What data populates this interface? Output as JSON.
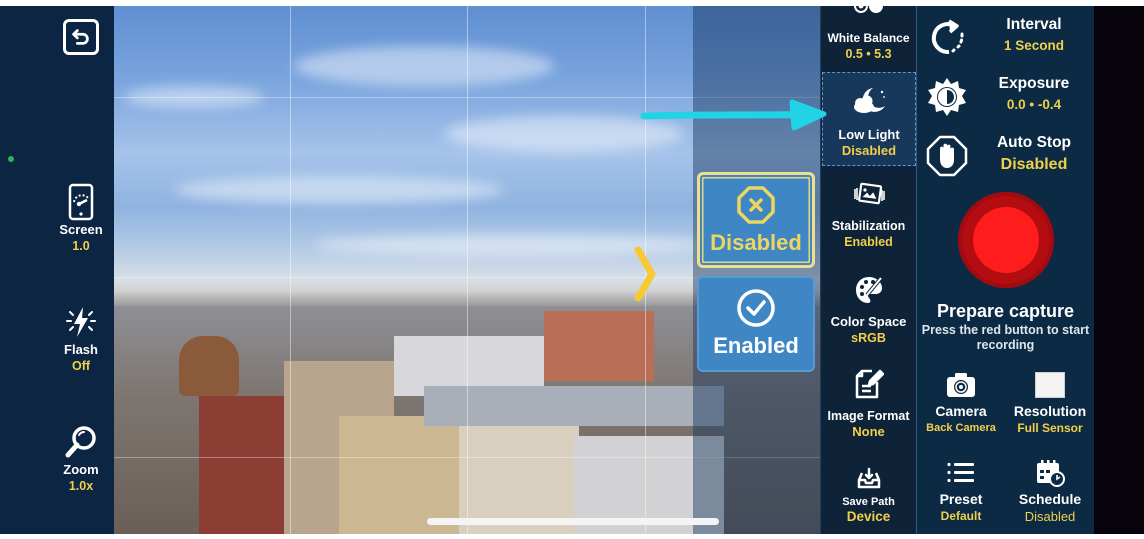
{
  "left_sidebar": {
    "back_icon": "back-arrow-icon",
    "items": [
      {
        "icon": "screen-brightness-icon",
        "label": "Screen",
        "value": "1.0"
      },
      {
        "icon": "flash-icon",
        "label": "Flash",
        "value": "Off"
      },
      {
        "icon": "zoom-magnifier-icon",
        "label": "Zoom",
        "value": "1.0x"
      }
    ]
  },
  "picker": {
    "options": [
      {
        "icon": "x-octagon-icon",
        "label": "Disabled",
        "selected": true
      },
      {
        "icon": "check-circle-icon",
        "label": "Enabled",
        "selected": false
      }
    ]
  },
  "settings_column": {
    "items": [
      {
        "icon": "white-balance-icon",
        "label": "White Balance",
        "value": "0.5 • 5.3"
      },
      {
        "icon": "moon-cloud-icon",
        "label": "Low Light",
        "value": "Disabled",
        "highlighted": true
      },
      {
        "icon": "stabilization-icon",
        "label": "Stabilization",
        "value": "Enabled"
      },
      {
        "icon": "palette-icon",
        "label": "Color Space",
        "value": "sRGB"
      },
      {
        "icon": "edit-document-icon",
        "label": "Image Format",
        "value": "None"
      },
      {
        "icon": "save-tray-icon",
        "label": "Save Path",
        "value": "Device"
      }
    ]
  },
  "control_column": {
    "rows": [
      {
        "icon": "interval-refresh-icon",
        "label": "Interval",
        "value": "1 Second"
      },
      {
        "icon": "exposure-sun-icon",
        "label": "Exposure",
        "value": "0.0 • -0.4"
      },
      {
        "icon": "hand-stop-icon",
        "label": "Auto Stop",
        "value": "Disabled"
      }
    ],
    "record_button": {
      "icon": "record-icon"
    },
    "prepare_title": "Prepare capture",
    "prepare_subtitle": "Press the red button to start recording",
    "grid": [
      {
        "icon": "camera-icon",
        "label": "Camera",
        "value": "Back Camera"
      },
      {
        "icon": "resolution-square-icon",
        "label": "Resolution",
        "value": "Full Sensor"
      },
      {
        "icon": "preset-list-icon",
        "label": "Preset",
        "value": "Default"
      },
      {
        "icon": "schedule-calendar-icon",
        "label": "Schedule",
        "value": "Disabled"
      }
    ]
  },
  "colors": {
    "accent_yellow": "#f0d04a",
    "panel_dark": "#0b2542",
    "option_blue": "#3f86c4",
    "record_red": "#ff1c1c",
    "annotation_cyan": "#22d3e6"
  }
}
